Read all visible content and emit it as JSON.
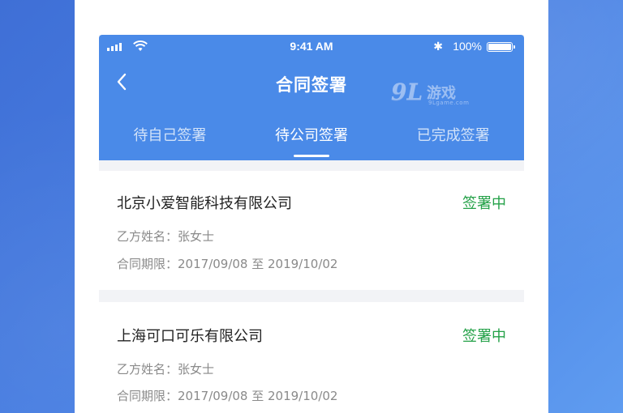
{
  "statusbar": {
    "time": "9:41 AM",
    "battery": "100%",
    "bluetooth_glyph": "✱"
  },
  "header": {
    "title": "合同签署",
    "watermark": {
      "number": "9L",
      "text": "游戏",
      "url": "9Lgame.com"
    }
  },
  "tabs": [
    {
      "label": "待自己签署",
      "active": false
    },
    {
      "label": "待公司签署",
      "active": true
    },
    {
      "label": "已完成签署",
      "active": false
    }
  ],
  "contracts": [
    {
      "company": "北京小爱智能科技有限公司",
      "status": "签署中",
      "party_b_label": "乙方姓名：",
      "party_b": "张女士",
      "period_label": "合同期限：",
      "period": "2017/09/08 至 2019/10/02"
    },
    {
      "company": "上海可口可乐有限公司",
      "status": "签署中",
      "party_b_label": "乙方姓名：",
      "party_b": "张女士",
      "period_label": "合同期限：",
      "period": "2017/09/08 至 2019/10/02"
    }
  ],
  "colors": {
    "header_blue": "#4a8ae8",
    "status_green": "#24a148",
    "background_blue": "#4a82e4"
  }
}
